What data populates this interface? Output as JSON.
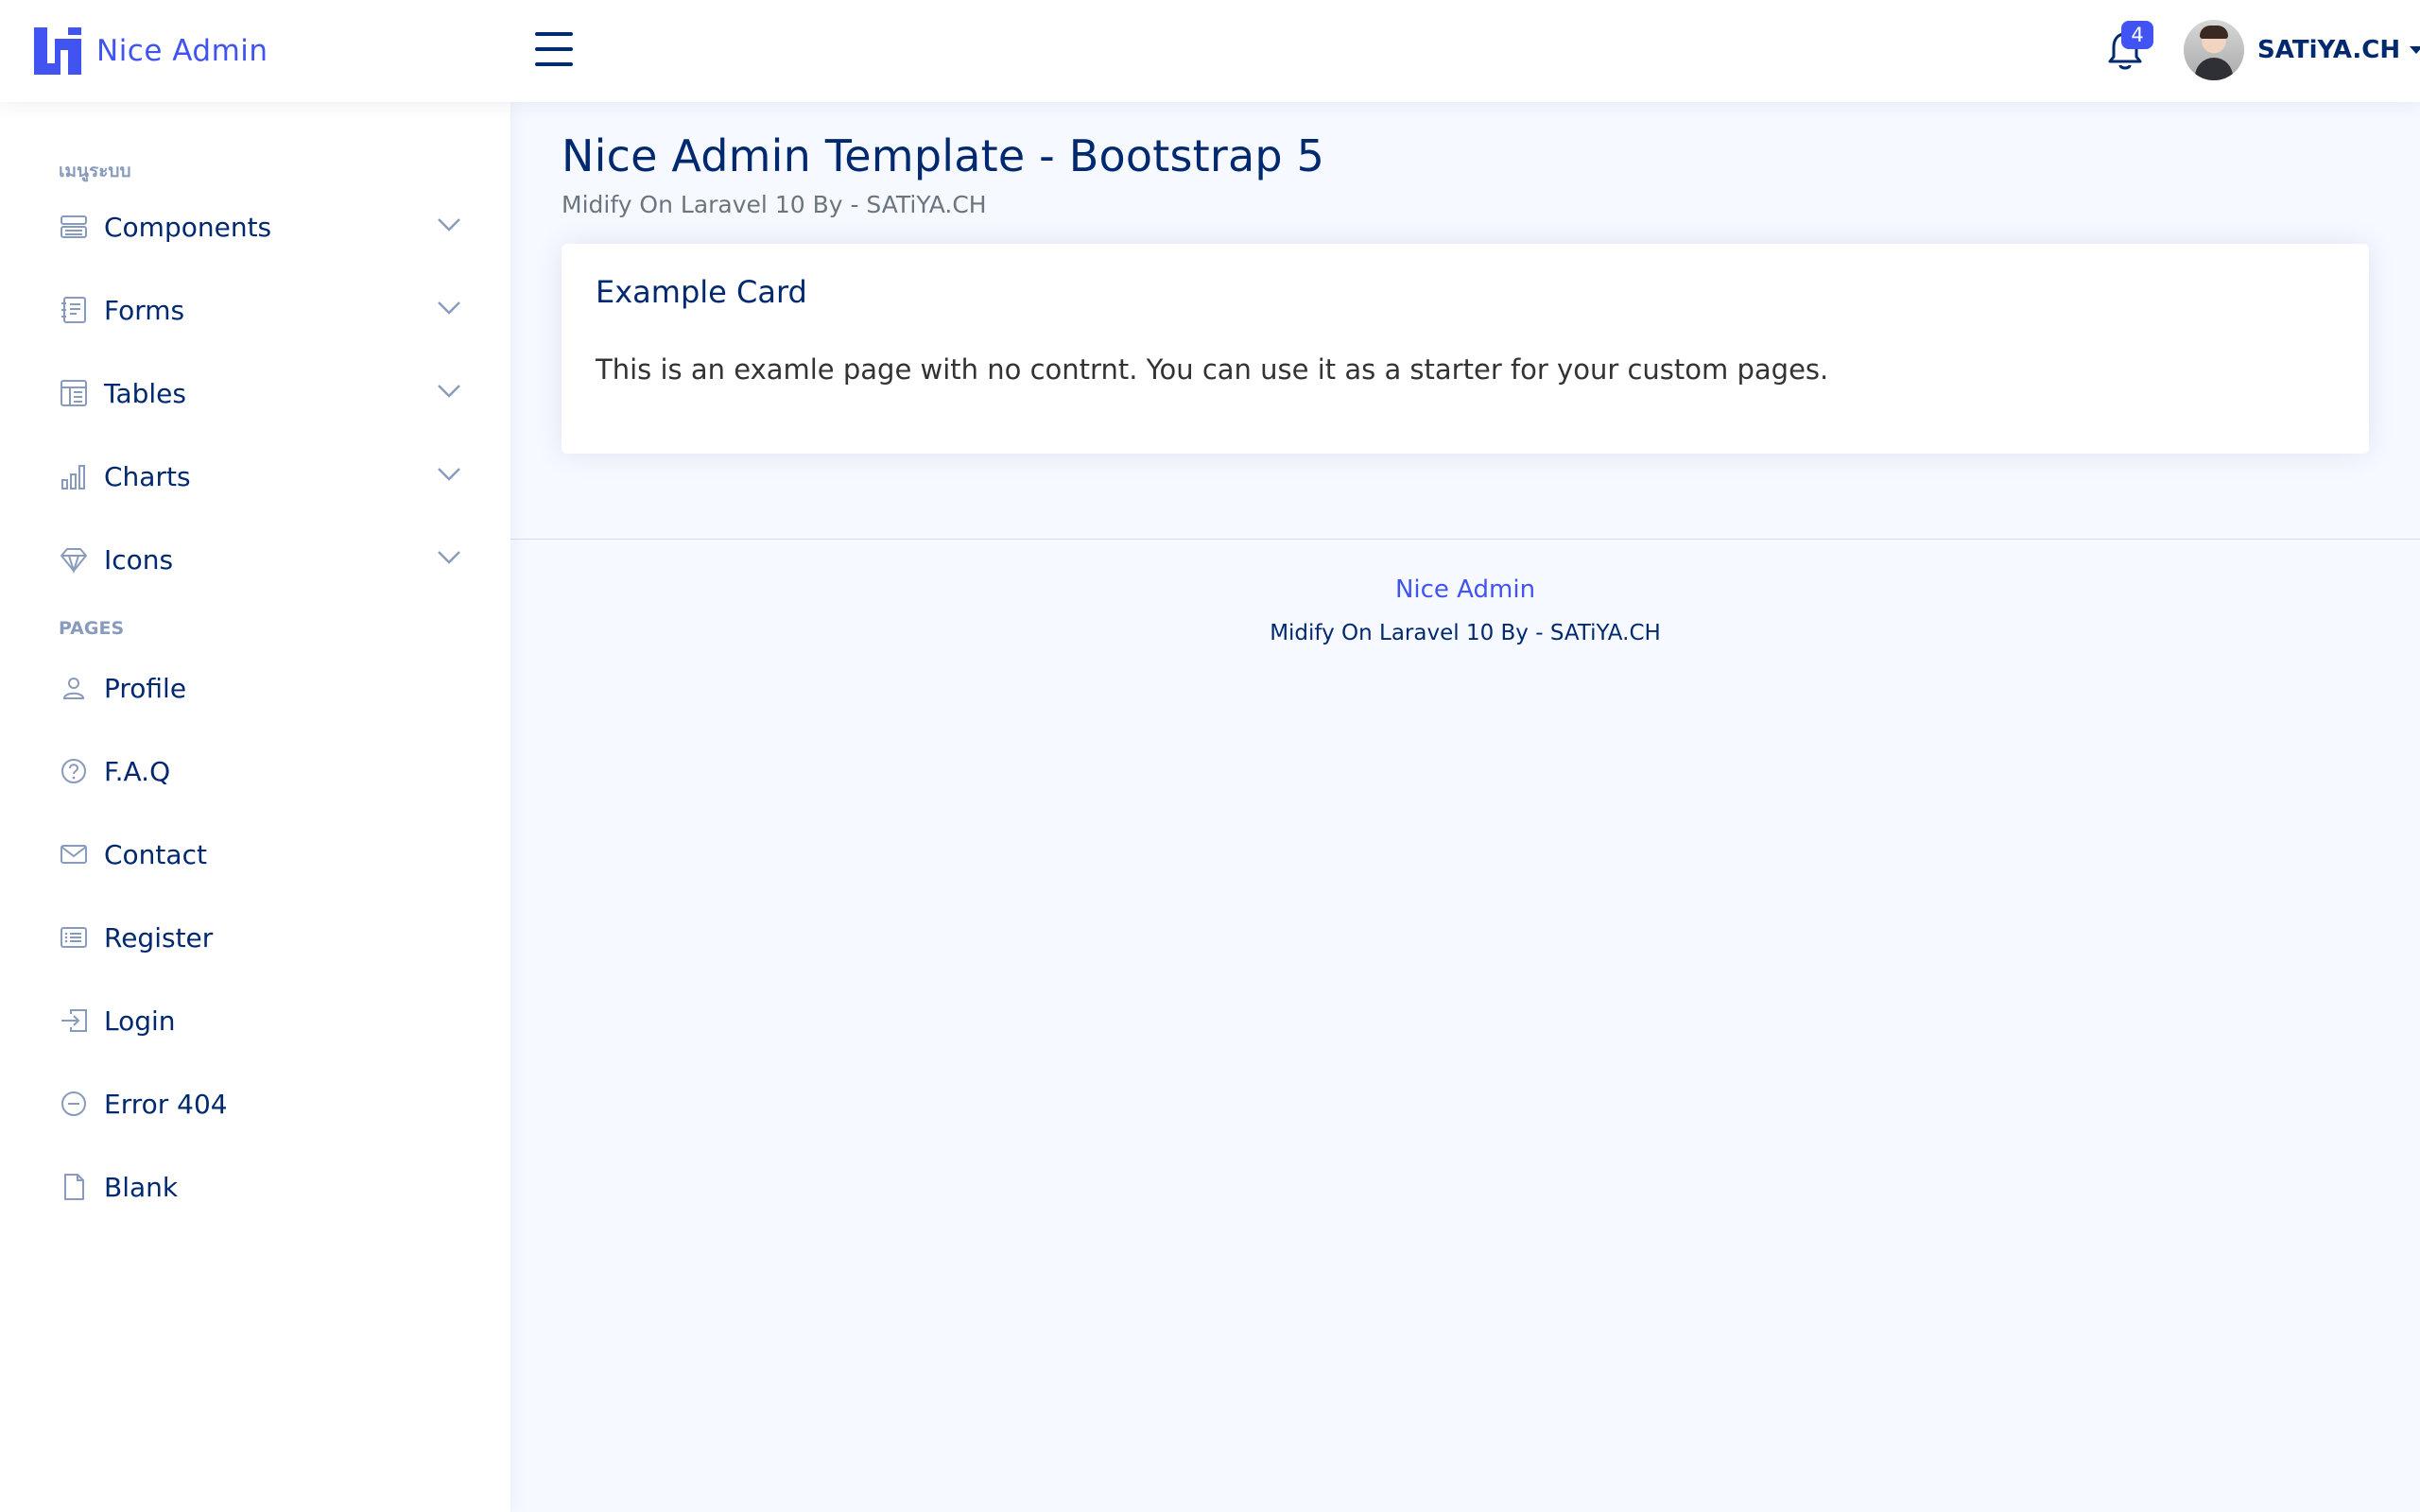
{
  "header": {
    "brand": "Nice Admin",
    "notifications_count": "4",
    "profile_name": "SATiYA.CH"
  },
  "sidebar": {
    "heading_main": "เมนูระบบ",
    "components": [
      {
        "label": "Components",
        "icon": "menu-button-icon"
      },
      {
        "label": "Forms",
        "icon": "journal-text-icon"
      },
      {
        "label": "Tables",
        "icon": "layout-text-window-icon"
      },
      {
        "label": "Charts",
        "icon": "bar-chart-icon"
      },
      {
        "label": "Icons",
        "icon": "gem-icon"
      }
    ],
    "heading_pages": "PAGES",
    "pages": [
      {
        "label": "Profile",
        "icon": "person-icon"
      },
      {
        "label": "F.A.Q",
        "icon": "question-circle-icon"
      },
      {
        "label": "Contact",
        "icon": "envelope-icon"
      },
      {
        "label": "Register",
        "icon": "card-list-icon"
      },
      {
        "label": "Login",
        "icon": "box-arrow-in-right-icon"
      },
      {
        "label": "Error 404",
        "icon": "dash-circle-icon"
      },
      {
        "label": "Blank",
        "icon": "file-icon"
      }
    ]
  },
  "main": {
    "title": "Nice Admin Template - Bootstrap 5",
    "subtitle": "Midify On Laravel 10 By - SATiYA.CH",
    "card": {
      "title": "Example Card",
      "text": "This is an examle page with no contrnt. You can use it as a starter for your custom pages."
    }
  },
  "footer": {
    "brand": "Nice Admin",
    "credit": "Midify On Laravel 10 By - SATiYA.CH"
  },
  "colors": {
    "primary": "#4154f1",
    "text": "#012970",
    "background": "#f6f9ff",
    "muted": "#899bbd"
  }
}
